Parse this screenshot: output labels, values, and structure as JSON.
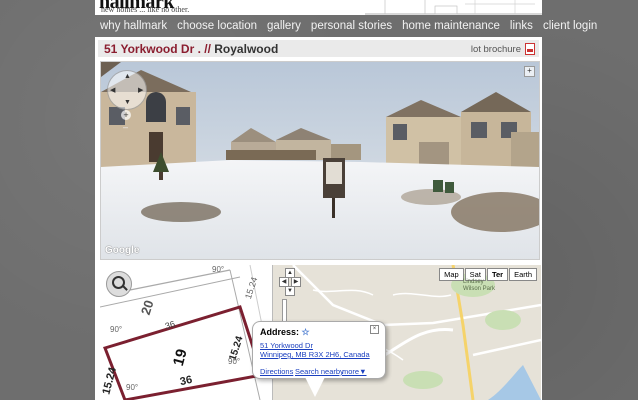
{
  "header": {
    "logo_text": "hallmark",
    "tagline": "new homes ... like no other."
  },
  "nav": {
    "items": [
      {
        "label": "why hallmark"
      },
      {
        "label": "choose location"
      },
      {
        "label": "gallery"
      },
      {
        "label": "personal stories"
      },
      {
        "label": "home maintenance"
      },
      {
        "label": "links"
      },
      {
        "label": "client login"
      }
    ]
  },
  "lot": {
    "address": "51 Yorkwood Dr .",
    "separator": " // ",
    "community": "Royalwood",
    "brochure_label": "lot brochure"
  },
  "street_view": {
    "google_label": "Google"
  },
  "plot": {
    "lot_number": "19",
    "adjacent_lot": "20",
    "dim_top": "36",
    "dim_bottom": "36",
    "dim_side_left": "15.24",
    "dim_side_right": "15.24",
    "dim_top_right": "15.24",
    "angle_a": "90°",
    "angle_b": "90°",
    "angle_c": "90°",
    "angle_d": "90°"
  },
  "map": {
    "types": [
      {
        "label": "Map"
      },
      {
        "label": "Sat"
      },
      {
        "label": "Ter",
        "active": true
      },
      {
        "label": "Earth"
      }
    ],
    "info": {
      "title": "Address:",
      "line1": "51 Yorkwood Dr",
      "line2": "Winnipeg, MB R3X 2H6, Canada",
      "links": [
        "Directions",
        "Search nearby",
        "more▼"
      ]
    },
    "place_labels": [
      "Lindsey Wilson Park"
    ]
  },
  "colors": {
    "accent": "#8b1d2f",
    "background": "#6e6e6e",
    "link": "#1a3fbf"
  }
}
